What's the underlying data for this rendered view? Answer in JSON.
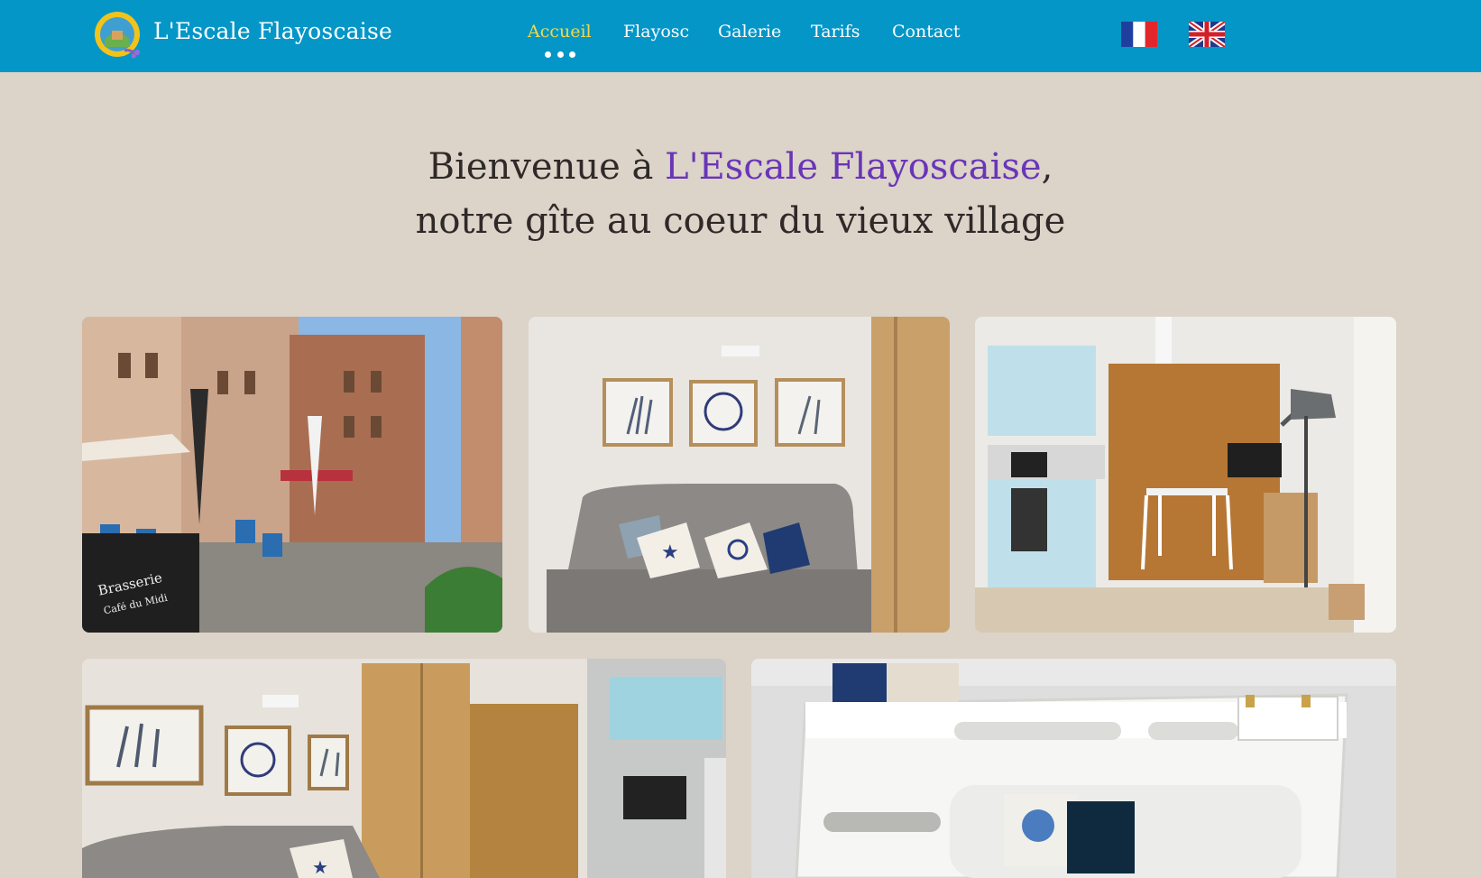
{
  "header": {
    "brand": "L'Escale Flayoscaise",
    "nav": [
      {
        "label": "Accueil",
        "active": true
      },
      {
        "label": "Flayosc",
        "active": false
      },
      {
        "label": "Galerie",
        "active": false
      },
      {
        "label": "Tarifs",
        "active": false
      },
      {
        "label": "Contact",
        "active": false
      }
    ],
    "languages": [
      {
        "name": "flag-france-icon"
      },
      {
        "name": "flag-uk-icon"
      }
    ]
  },
  "hero": {
    "line1_prefix": "Bienvenue à ",
    "line1_accent": "L'Escale Flayoscaise",
    "line1_suffix": ",",
    "line2": "notre gîte au coeur du vieux village"
  },
  "gallery": {
    "photos": [
      {
        "name": "photo-village-square",
        "sign_text_1": "Brasserie",
        "sign_text_2": "Café du Midi"
      },
      {
        "name": "photo-living-room-sofa"
      },
      {
        "name": "photo-kitchen-dining"
      },
      {
        "name": "photo-living-room-wardrobe"
      },
      {
        "name": "photo-bunk-bed"
      }
    ]
  },
  "colors": {
    "header_bg": "#0496c7",
    "page_bg": "#dcd3c9",
    "active_nav": "#f1d84a",
    "accent": "#6a35b8"
  }
}
